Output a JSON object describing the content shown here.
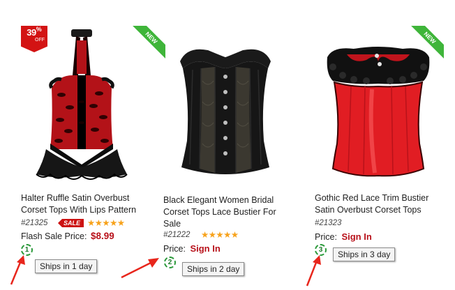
{
  "products": [
    {
      "title_line1": "Halter Ruffle Satin Overbust",
      "title_line2": "Corset Tops With Lips Pattern",
      "title_line3": "",
      "sku": "#21325",
      "sale_badge": "SALE",
      "stars": "★★★★★",
      "price_label": "Flash Sale Price:",
      "price_value": "$8.99",
      "discount_number": "39",
      "discount_percent": "%",
      "discount_off": "OFF",
      "new_label": "NEW",
      "ship_circle_number": "1",
      "ship_tooltip": "Ships in 1 day"
    },
    {
      "title_line1": "Black Elegant Women Bridal",
      "title_line2": "Corset Tops Lace Bustier For",
      "title_line3": "Sale",
      "sku": "#21222",
      "stars": "★★★★★",
      "price_label": "Price:",
      "price_value": "Sign In",
      "ship_circle_number": "2",
      "ship_tooltip": "Ships in 2 day"
    },
    {
      "title_line1": "Gothic Red Lace Trim Bustier",
      "title_line2": "Satin Overbust Corset Tops",
      "title_line3": "",
      "sku": "#21323",
      "price_label": "Price:",
      "price_value": "Sign In",
      "new_label": "NEW",
      "ship_circle_number": "3",
      "ship_tooltip": "Ships in 3 day"
    }
  ],
  "colors": {
    "price_red": "#b8121b",
    "sale_red": "#d31313",
    "new_green": "#3fb53a",
    "star_orange": "#f7a21b",
    "ship_green": "#2a9a3a",
    "arrow_red": "#e8261c"
  },
  "icons": {
    "rating": "star-icon",
    "ships": "ship-days-circle-icon",
    "pointer": "red-arrow-icon"
  }
}
